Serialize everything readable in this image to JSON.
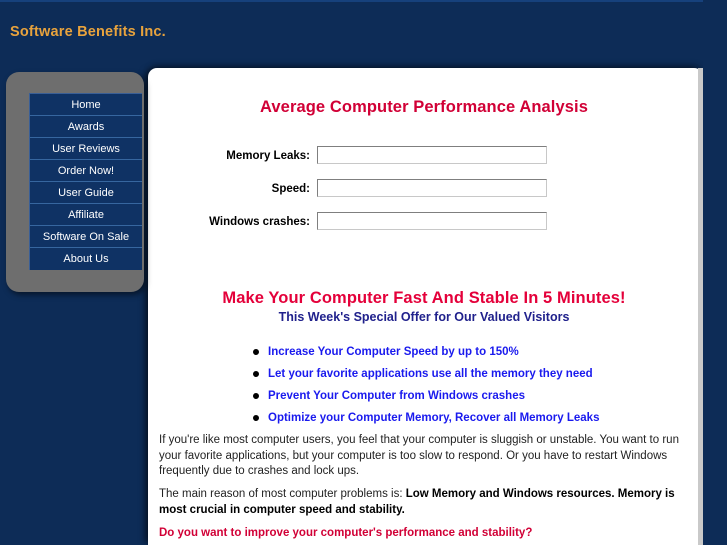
{
  "header": {
    "logo_text": "Software Benefits Inc.",
    "logo_color": "#e8a33d",
    "band_color": "#0d2c57"
  },
  "sidebar": {
    "items": [
      {
        "label": "Home"
      },
      {
        "label": "Awards"
      },
      {
        "label": "User Reviews"
      },
      {
        "label": "Order Now!"
      },
      {
        "label": "User Guide"
      },
      {
        "label": "Affiliate"
      },
      {
        "label": "Software On Sale"
      },
      {
        "label": "About Us"
      }
    ]
  },
  "main": {
    "title": "Average Computer Performance Analysis",
    "title_color": "#d10036",
    "form": {
      "fields": [
        {
          "label": "Memory Leaks:",
          "value": "",
          "placeholder": ""
        },
        {
          "label": "Speed:",
          "value": "",
          "placeholder": ""
        },
        {
          "label": "Windows crashes:",
          "value": "",
          "placeholder": ""
        }
      ]
    },
    "headline": "Make Your Computer Fast And Stable In 5 Minutes!",
    "headline_color": "#e4003a",
    "subheadline": "This Week's Special Offer for Our Valued Visitors",
    "subheadline_color": "#20218c",
    "bullets": [
      "Increase Your Computer Speed by up to 150%",
      "Let your favorite applications use all the memory they need",
      "Prevent Your Computer from Windows crashes",
      "Optimize your Computer Memory, Recover all Memory Leaks"
    ],
    "bullet_color": "#1a1aee",
    "paragraph1": "If you're like most computer users, you feel that your computer is sluggish or unstable. You want to run your favorite applications, but your computer is too slow to respond. Or you have to restart Windows frequently due to crashes and lock ups.",
    "paragraph2_lead": "The main reason of most computer problems is: ",
    "paragraph2_emphasis": "Low Memory and Windows resources. Memory is most crucial in computer speed and stability.",
    "closing_question": "Do you want to improve your computer's performance and stability?",
    "closing_color": "#d10036"
  }
}
